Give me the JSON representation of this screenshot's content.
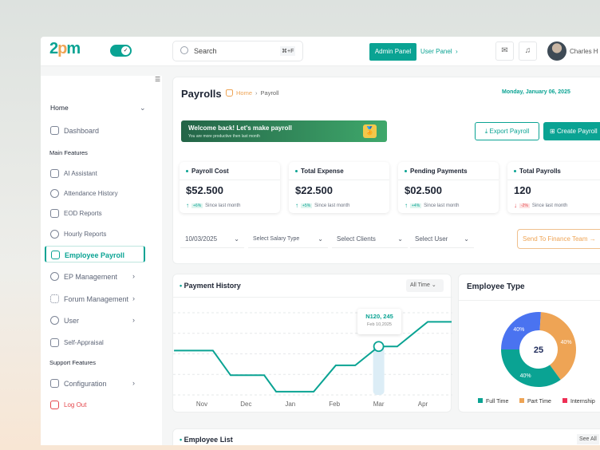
{
  "header": {
    "logo": "2pm",
    "search_placeholder": "Search",
    "shortcut": "⌘+F",
    "admin_panel": "Admin Panel",
    "user_panel": "User Panel",
    "user_name": "Charles H"
  },
  "sidebar": {
    "home": "Home",
    "dashboard": "Dashboard",
    "main_features": "Main Features",
    "items": [
      {
        "label": "AI Assistant"
      },
      {
        "label": "Attendance History"
      },
      {
        "label": "EOD Reports"
      },
      {
        "label": "Hourly Reports"
      },
      {
        "label": "Employee Payroll"
      },
      {
        "label": "EP Management"
      },
      {
        "label": "Forum Management"
      },
      {
        "label": "User"
      },
      {
        "label": "Self-Appraisal"
      }
    ],
    "support_features": "Support Features",
    "configuration": "Configuration",
    "logout": "Log Out"
  },
  "page": {
    "title": "Payrolls",
    "breadcrumb_home": "Home",
    "breadcrumb_current": "Payroll",
    "date": "Monday, January 06, 2025",
    "banner_title": "Welcome back! Let's make payroll",
    "banner_sub": "You are more productive then last month",
    "export": "Export Payroll",
    "create": "Create Payroll"
  },
  "stats": [
    {
      "title": "Payroll Cost",
      "value": "$52.500",
      "change": "+6%",
      "note": "Since last month",
      "dir": "up"
    },
    {
      "title": "Total Expense",
      "value": "$22.500",
      "change": "+5%",
      "note": "Since last month",
      "dir": "up"
    },
    {
      "title": "Pending Payments",
      "value": "$02.500",
      "change": "+4%",
      "note": "Since last month",
      "dir": "up"
    },
    {
      "title": "Total Payrolls",
      "value": "120",
      "change": "-2%",
      "note": "Since last month",
      "dir": "down"
    }
  ],
  "filters": {
    "date": "10/03/2025",
    "salary": "Select Salary Type",
    "clients": "Select Clients",
    "user": "Select User",
    "send": "Send To Finance Team →"
  },
  "payment_history": {
    "title": "Payment History",
    "range": "All Time",
    "tooltip_value": "N120, 245",
    "tooltip_date": "Feb 10,2025"
  },
  "employee_type": {
    "title": "Employee Type",
    "total": "25"
  },
  "employee_list": {
    "title": "Employee List",
    "see_all": "See All"
  },
  "chart_data": [
    {
      "type": "line",
      "title": "Payment History",
      "categories": [
        "Nov",
        "Dec",
        "Jan",
        "Feb",
        "Mar",
        "Apr"
      ],
      "x": [
        -0.63,
        0.25,
        0.65,
        1.41,
        1.68,
        2.53,
        3.03,
        3.47,
        4.0,
        4.42,
        5.11,
        5.65
      ],
      "y": [
        54,
        54,
        24,
        24,
        4,
        4,
        36,
        36,
        59,
        59,
        89,
        89
      ],
      "ylim": [
        0,
        100
      ],
      "grid": true,
      "highlight_x": 4.0
    },
    {
      "type": "pie",
      "title": "Employee Type",
      "center_label": "25",
      "slices": [
        {
          "name": "Full Time",
          "label": "40%",
          "share": 0.35,
          "color": "#0aa393"
        },
        {
          "name": "Part Time",
          "label": "40%",
          "share": 0.39,
          "color": "#eea455"
        },
        {
          "name": "Internship",
          "label": "40%",
          "share": 0.26,
          "color": "#4a73f0"
        }
      ],
      "legend": [
        {
          "name": "Full Time",
          "color": "#0aa393"
        },
        {
          "name": "Part Time",
          "color": "#eea455"
        },
        {
          "name": "Internship",
          "color": "#ee2f55"
        }
      ],
      "legend_position": "bottom"
    }
  ]
}
